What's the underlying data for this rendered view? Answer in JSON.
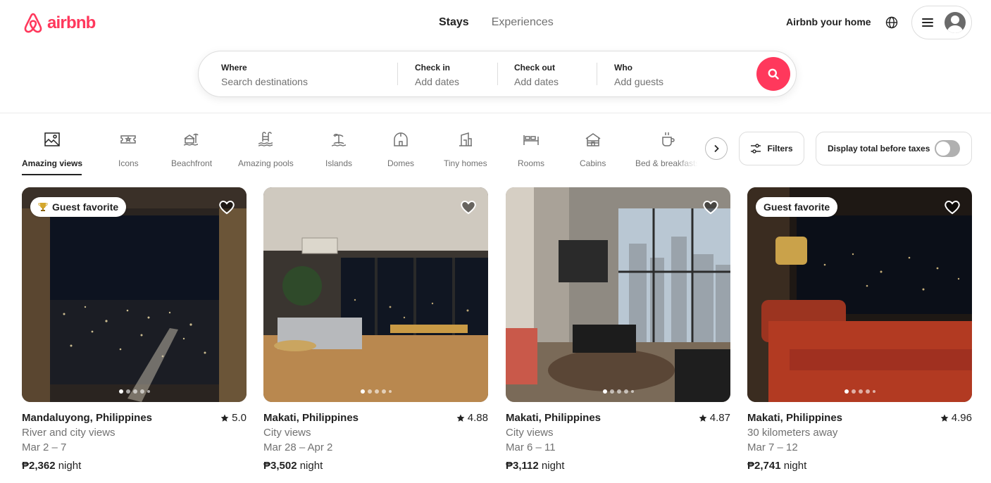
{
  "brand": {
    "name": "airbnb",
    "color": "#ff385c"
  },
  "header": {
    "tabs": [
      {
        "label": "Stays",
        "active": true
      },
      {
        "label": "Experiences",
        "active": false
      }
    ],
    "host_link": "Airbnb your home"
  },
  "search": {
    "where": {
      "label": "Where",
      "placeholder": "Search destinations"
    },
    "check_in": {
      "label": "Check in",
      "placeholder": "Add dates"
    },
    "check_out": {
      "label": "Check out",
      "placeholder": "Add dates"
    },
    "who": {
      "label": "Who",
      "placeholder": "Add guests"
    }
  },
  "categories": [
    {
      "label": "Amazing views",
      "icon": "amazing-views-icon",
      "active": true
    },
    {
      "label": "Icons",
      "icon": "icons-ticket-icon",
      "active": false
    },
    {
      "label": "Beachfront",
      "icon": "beachfront-icon",
      "active": false
    },
    {
      "label": "Amazing pools",
      "icon": "pool-icon",
      "active": false
    },
    {
      "label": "Islands",
      "icon": "island-icon",
      "active": false
    },
    {
      "label": "Domes",
      "icon": "dome-icon",
      "active": false
    },
    {
      "label": "Tiny homes",
      "icon": "tiny-home-icon",
      "active": false
    },
    {
      "label": "Rooms",
      "icon": "rooms-bed-icon",
      "active": false
    },
    {
      "label": "Cabins",
      "icon": "cabin-icon",
      "active": false
    },
    {
      "label": "Bed & breakfasts",
      "icon": "coffee-cup-icon",
      "active": false
    }
  ],
  "filters": {
    "label": "Filters"
  },
  "tax_toggle": {
    "label": "Display total before taxes",
    "on": false
  },
  "listings": [
    {
      "location": "Mandaluyong, Philippines",
      "rating": "5.0",
      "description": "River and city views",
      "dates": "Mar 2 – 7",
      "price": "₱2,362",
      "price_unit": "night",
      "badge": "Guest favorite",
      "badge_trophy": true,
      "photo": "night-city-window-with-curtains"
    },
    {
      "location": "Makati, Philippines",
      "rating": "4.88",
      "description": "City views",
      "dates": "Mar 28 – Apr 2",
      "price": "₱3,502",
      "price_unit": "night",
      "badge": "",
      "badge_trophy": false,
      "photo": "living-room-night-skyline"
    },
    {
      "location": "Makati, Philippines",
      "rating": "4.87",
      "description": "City views",
      "dates": "Mar 6 – 11",
      "price": "₱3,112",
      "price_unit": "night",
      "badge": "",
      "badge_trophy": false,
      "photo": "daytime-condo-living-room"
    },
    {
      "location": "Makati, Philippines",
      "rating": "4.96",
      "description": "30 kilometers away",
      "dates": "Mar 7 – 12",
      "price": "₱2,741",
      "price_unit": "night",
      "badge": "Guest favorite",
      "badge_trophy": false,
      "photo": "bedroom-night-city-view"
    }
  ]
}
